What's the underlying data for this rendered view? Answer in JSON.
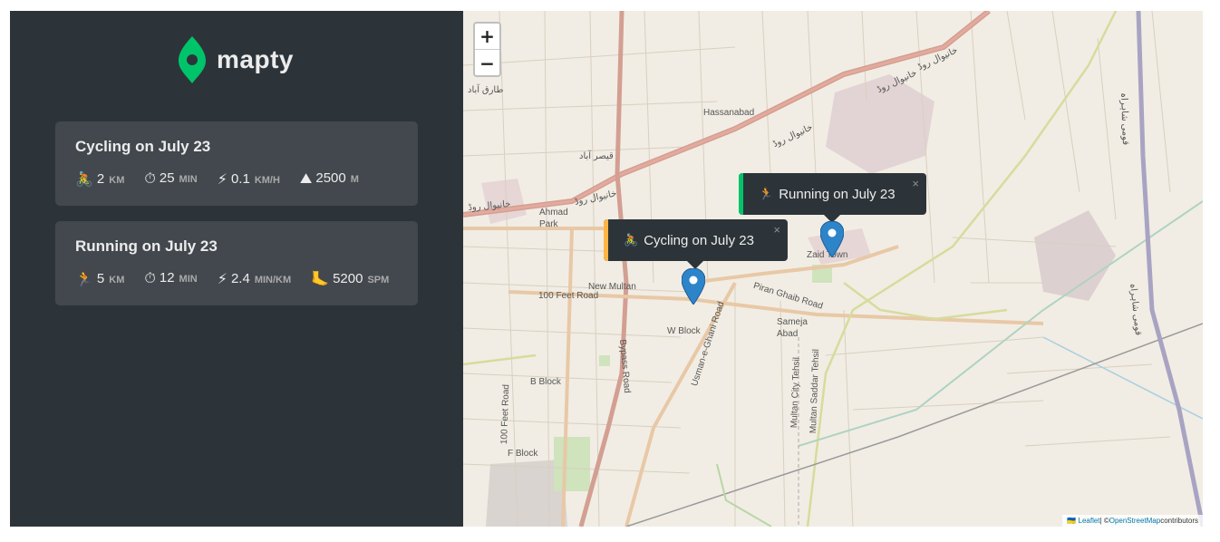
{
  "app": {
    "name": "mapty"
  },
  "colors": {
    "brand": "#00c46a",
    "cycling": "#ffb545",
    "running": "#00c46a",
    "sidebar_bg": "#2d3439",
    "card_bg": "#42484d"
  },
  "workouts": [
    {
      "type": "cycling",
      "title": "Cycling on July 23",
      "details": [
        {
          "icon": "cycling-icon",
          "emoji": "🚴",
          "value": "2",
          "unit": "km"
        },
        {
          "icon": "stopwatch-icon",
          "emoji": "⏱",
          "value": "25",
          "unit": "min"
        },
        {
          "icon": "lightning-icon",
          "emoji": "⚡",
          "value": "0.1",
          "unit": "km/h"
        },
        {
          "icon": "mountain-icon",
          "emoji": "⛰",
          "value": "2500",
          "unit": "m"
        }
      ]
    },
    {
      "type": "running",
      "title": "Running on July 23",
      "details": [
        {
          "icon": "running-icon",
          "emoji": "🏃",
          "value": "5",
          "unit": "km"
        },
        {
          "icon": "stopwatch-icon",
          "emoji": "⏱",
          "value": "12",
          "unit": "min"
        },
        {
          "icon": "lightning-icon",
          "emoji": "⚡",
          "value": "2.4",
          "unit": "min/km"
        },
        {
          "icon": "footprint-icon",
          "emoji": "🦶",
          "value": "5200",
          "unit": "spm"
        }
      ]
    }
  ],
  "map": {
    "zoom_in": "+",
    "zoom_out": "−",
    "popups": [
      {
        "emoji": "🏃",
        "label": "Running on July 23",
        "close": "×"
      },
      {
        "emoji": "🚴",
        "label": "Cycling on July 23",
        "close": "×"
      }
    ],
    "labels": {
      "hassanabad": "Hassanabad",
      "ahmad_park": "Ahmad Park",
      "new_multan": "New Multan",
      "feet_road_100": "100 Feet Road",
      "w_block": "W Block",
      "b_block": "B Block",
      "f_block": "F Block",
      "zaid_town": "Zaid Town",
      "sameja_abad": "Sameja Abad",
      "piran_ghaib": "Piran Ghaib Road",
      "usman_ghani": "Usman-e-Ghani Road",
      "bypass_road": "Bypass Road",
      "multan_city_tehsil": "Multan City Tehsil",
      "multan_saddar_tehsil": "Multan Saddar Tehsil",
      "feet_road_100_v": "100 Feet Road",
      "tariq_abad": "طارق آباد",
      "qaisar_abad": "قیصر آباد",
      "khanewal_road_1": "خانیوال روڈ",
      "khanewal_road_2": "خانیوال روڈ",
      "khanewal_road_3": "خانیوال روڈ",
      "khanewal_road_4": "خانیوال روڈ",
      "khanewal_road_5": "خانیوال روڈ",
      "qaumi_shahrah_1": "قومی شاہراہ",
      "qaumi_shahrah_2": "قومی شاہراہ"
    },
    "attribution": {
      "leaflet": "🇺🇦 Leaflet",
      "sep": " | © ",
      "osm": "OpenStreetMap",
      "contributors": " contributors"
    }
  }
}
